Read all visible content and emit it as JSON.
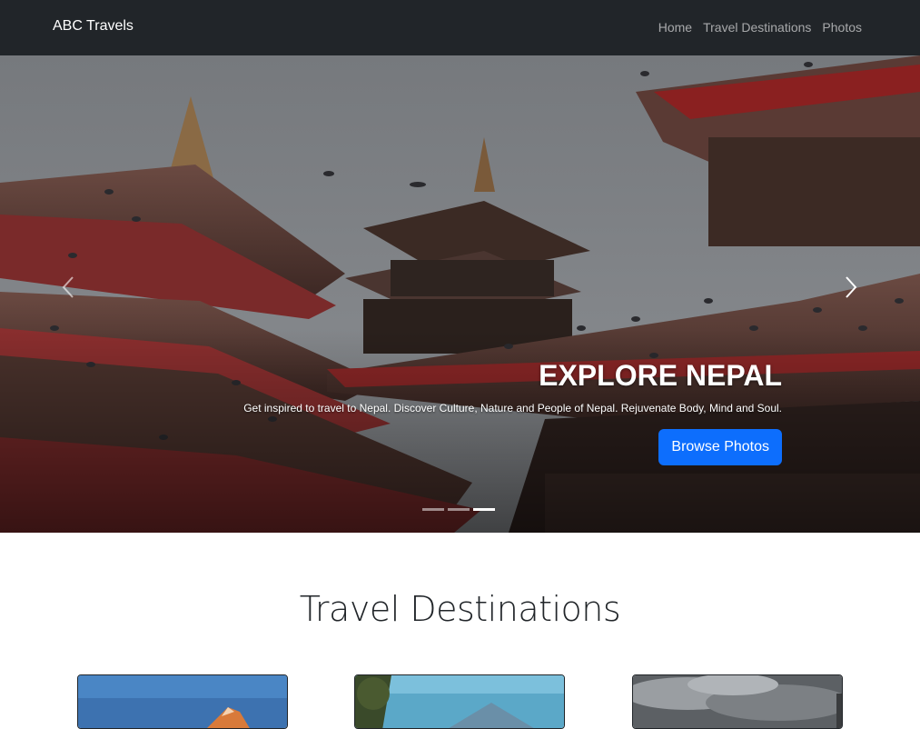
{
  "navbar": {
    "brand": "ABC Travels",
    "links": [
      {
        "label": "Home"
      },
      {
        "label": "Travel Destinations"
      },
      {
        "label": "Photos"
      }
    ]
  },
  "hero": {
    "title": "EXPLORE NEPAL",
    "text": "Get inspired to travel to Nepal. Discover Culture, Nature and People of Nepal. Rejuvenate Body, Mind and Soul.",
    "button_label": "Browse Photos",
    "slides_count": 3,
    "active_slide": 3,
    "prev_icon": "chevron-left-icon",
    "next_icon": "chevron-right-icon"
  },
  "destinations": {
    "title": "Travel Destinations",
    "cards": [
      {
        "image": "mountain-sunset-photo"
      },
      {
        "image": "mountain-trees-photo"
      },
      {
        "image": "cloudy-sky-photo"
      }
    ]
  },
  "colors": {
    "navbar": "#212529",
    "primary": "#0d6efd"
  }
}
